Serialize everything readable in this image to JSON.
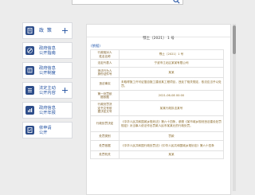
{
  "search": {
    "placeholder": "",
    "value": ""
  },
  "sidebar": {
    "items": [
      {
        "label": "政 策",
        "icon": "document-icon",
        "expandable": true
      },
      {
        "label": "政府信息\n公开指南",
        "icon": "pen-icon",
        "expandable": false
      },
      {
        "label": "政府信息\n公开制度",
        "icon": "book-icon",
        "expandable": false
      },
      {
        "label": "法定主动\n公开内容",
        "icon": "list-icon",
        "expandable": true
      },
      {
        "label": "政府信息\n公开年报",
        "icon": "chart-icon",
        "expandable": false
      },
      {
        "label": "依申请\n公开",
        "icon": "form-icon",
        "expandable": false
      }
    ]
  },
  "document": {
    "number": "鄂土〔2021〕 1 号",
    "basis_tag": "(依据)",
    "rows": [
      {
        "key": "行政相对人\n姓名名称",
        "value": "鄂土〔2021〕1 号"
      },
      {
        "key": "法定代表人",
        "value": "宁波市江北区某某有限公司"
      },
      {
        "key": "违法行为人\n身份证件号",
        "value": "某某"
      },
      {
        "key": "违法事实",
        "value": "未取得施工许可证擅自施工建设某工程项目，违反了相关规定，依法应当予以处罚。"
      },
      {
        "key": "第一处罚依\n据依据",
        "value": "2021-06-08 00:00"
      },
      {
        "key": "行政处罚决\n定书文号依\n据决定文号",
        "value": "某某行政执法某号"
      },
      {
        "key": "行政处罚决定",
        "value": "《中华人民共和国城乡规划法》第六十四条，参照《某市城乡规划违法建设处罚规定》对当事人依法作出罚款人民币某某元的行政处罚。"
      },
      {
        "key": "处罚类别",
        "value": "罚款"
      },
      {
        "key": "处罚依据",
        "value": "《中华人民共和国行政处罚法》《中华人民共和国城乡规划法》第六十四条"
      },
      {
        "key": "处罚机关",
        "value": "某某"
      }
    ]
  },
  "colors": {
    "accent": "#2d4d8a",
    "link": "#1f4fa0",
    "table_text": "#8a6a2a"
  }
}
